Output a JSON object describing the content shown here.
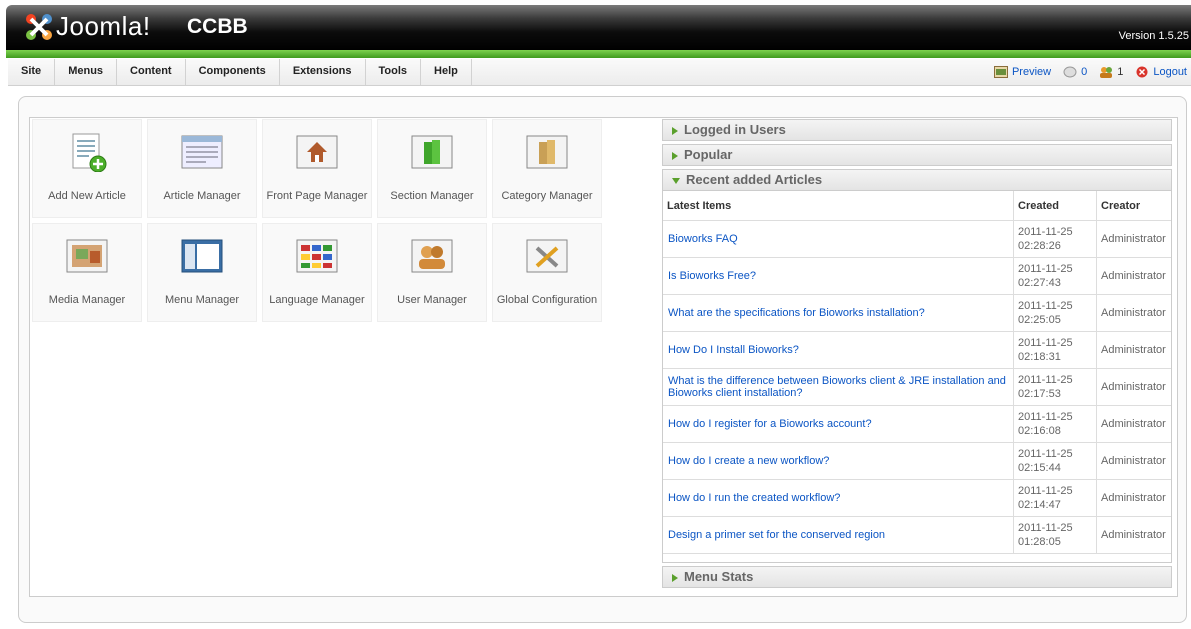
{
  "header": {
    "logo_text": "Joomla!",
    "site_name": "CCBB",
    "version": "Version 1.5.25"
  },
  "menu": [
    "Site",
    "Menus",
    "Content",
    "Components",
    "Extensions",
    "Tools",
    "Help"
  ],
  "status": {
    "preview": "Preview",
    "messages": "0",
    "users_online": "1",
    "logout": "Logout"
  },
  "cpanel": [
    {
      "label": "Add New Article",
      "icon": "add-article-icon"
    },
    {
      "label": "Article Manager",
      "icon": "article-manager-icon"
    },
    {
      "label": "Front Page Manager",
      "icon": "front-page-icon"
    },
    {
      "label": "Section Manager",
      "icon": "section-icon"
    },
    {
      "label": "Category Manager",
      "icon": "category-icon"
    },
    {
      "label": "Media Manager",
      "icon": "media-icon"
    },
    {
      "label": "Menu Manager",
      "icon": "menu-icon"
    },
    {
      "label": "Language Manager",
      "icon": "language-icon"
    },
    {
      "label": "User Manager",
      "icon": "user-icon"
    },
    {
      "label": "Global Configuration",
      "icon": "config-icon"
    }
  ],
  "panels": {
    "logged_in": "Logged in Users",
    "popular": "Popular",
    "recent": "Recent added Articles",
    "menu_stats": "Menu Stats"
  },
  "articles": {
    "headers": [
      "Latest Items",
      "Created",
      "Creator"
    ],
    "rows": [
      {
        "title": "Bioworks FAQ",
        "date": "2011-11-25",
        "time": "02:28:26",
        "creator": "Administrator"
      },
      {
        "title": "Is Bioworks Free?",
        "date": "2011-11-25",
        "time": "02:27:43",
        "creator": "Administrator"
      },
      {
        "title": "What are the specifications for Bioworks installation?",
        "date": "2011-11-25",
        "time": "02:25:05",
        "creator": "Administrator"
      },
      {
        "title": "How Do I Install Bioworks?",
        "date": "2011-11-25",
        "time": "02:18:31",
        "creator": "Administrator"
      },
      {
        "title": "What is the difference between Bioworks client & JRE installation and Bioworks client installation?",
        "date": "2011-11-25",
        "time": "02:17:53",
        "creator": "Administrator"
      },
      {
        "title": "How do I register for a Bioworks account?",
        "date": "2011-11-25",
        "time": "02:16:08",
        "creator": "Administrator"
      },
      {
        "title": "How do I create a new workflow?",
        "date": "2011-11-25",
        "time": "02:15:44",
        "creator": "Administrator"
      },
      {
        "title": "How do I run the created workflow?",
        "date": "2011-11-25",
        "time": "02:14:47",
        "creator": "Administrator"
      },
      {
        "title": "Design a primer set for the conserved region",
        "date": "2011-11-25",
        "time": "01:28:05",
        "creator": "Administrator"
      }
    ]
  }
}
